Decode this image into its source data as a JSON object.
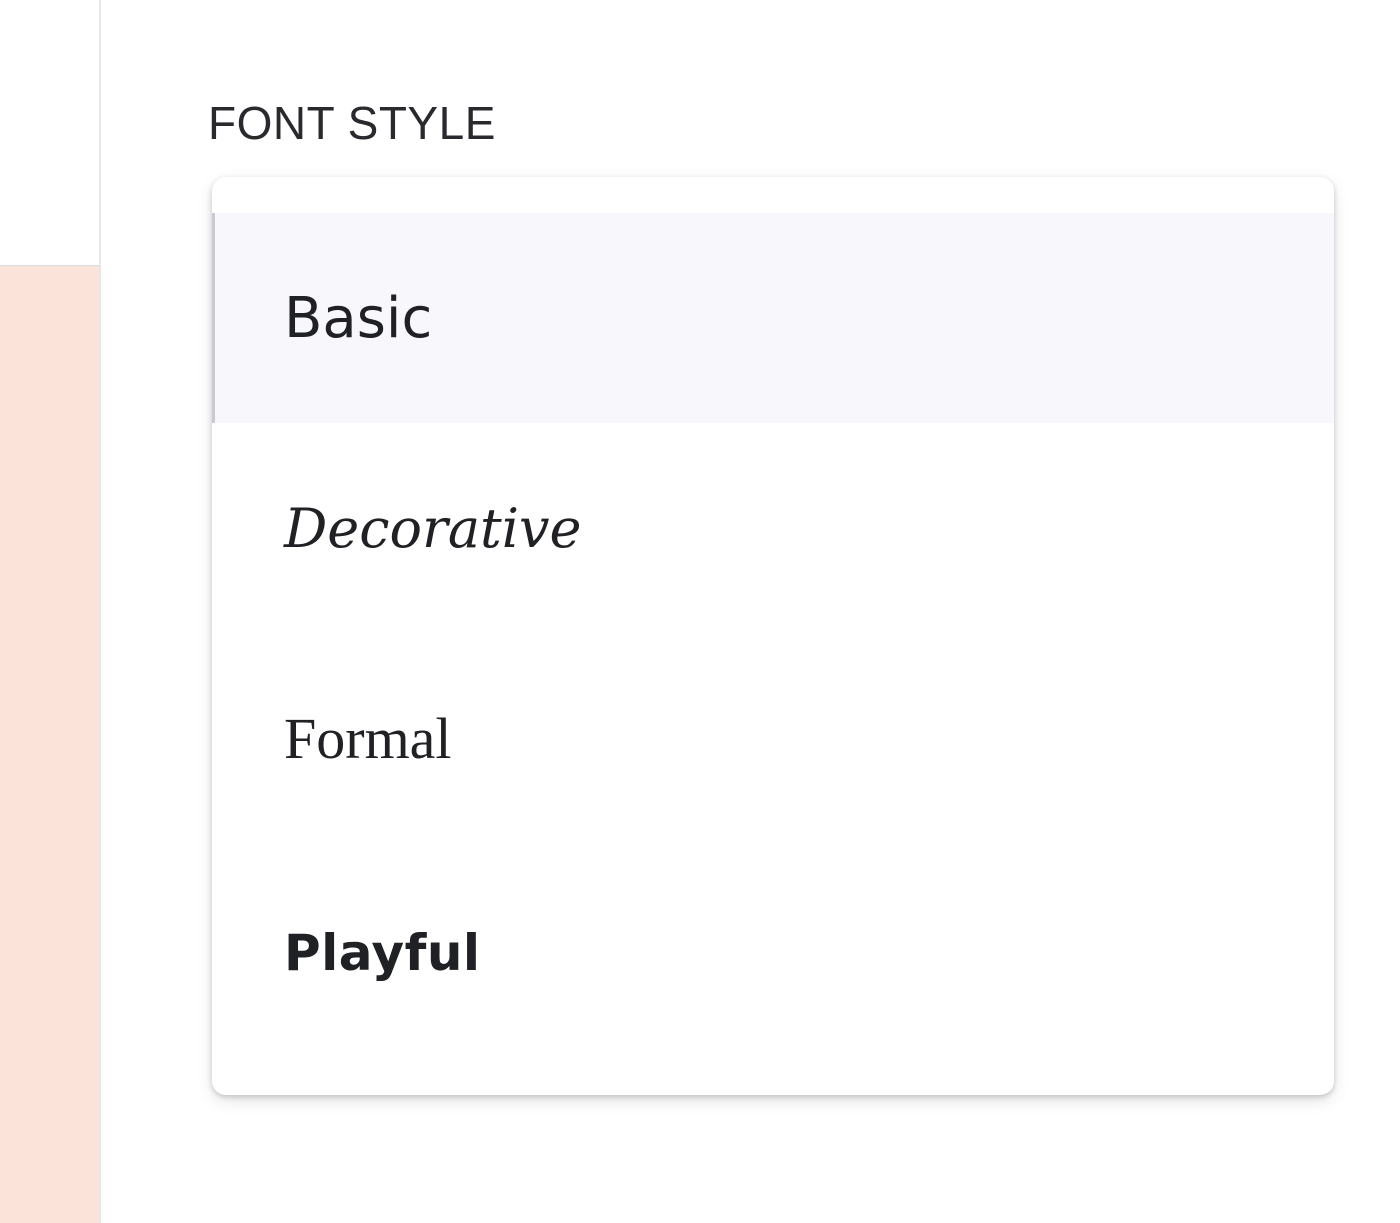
{
  "font_style": {
    "label": "FONT STYLE",
    "selected": "Basic",
    "options": [
      {
        "label": "Basic"
      },
      {
        "label": "Decorative"
      },
      {
        "label": "Formal"
      },
      {
        "label": "Playful"
      }
    ]
  },
  "colors": {
    "accent_background": "#fce3da",
    "selected_option_background": "#f8f8fc",
    "text": "#202124"
  }
}
